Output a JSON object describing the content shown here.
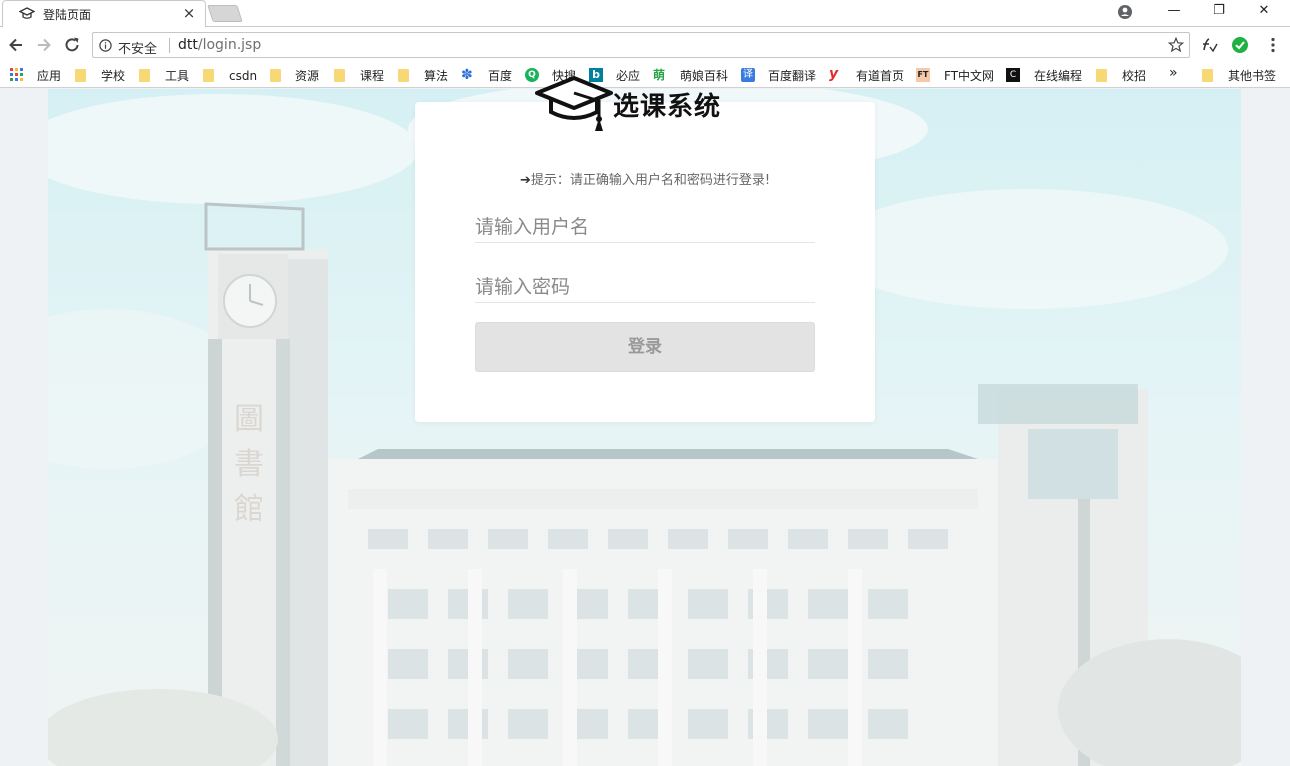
{
  "browser": {
    "tab_title": "登陆页面",
    "tab_close": "×",
    "security_label": "不安全",
    "url_host": "dtt",
    "url_path": "/login.jsp",
    "window_controls": {
      "minimize": "—",
      "restore": "❐",
      "close": "✕"
    }
  },
  "bookmarks": {
    "items": [
      {
        "label": "应用",
        "icon": "apps-grid-icon"
      },
      {
        "label": "学校",
        "icon": "folder-icon"
      },
      {
        "label": "工具",
        "icon": "folder-icon"
      },
      {
        "label": "csdn",
        "icon": "folder-icon"
      },
      {
        "label": "资源",
        "icon": "folder-icon"
      },
      {
        "label": "课程",
        "icon": "folder-icon"
      },
      {
        "label": "算法",
        "icon": "folder-icon"
      },
      {
        "label": "百度",
        "icon": "baidu-icon"
      },
      {
        "label": "快搜",
        "icon": "kuaisou-icon"
      },
      {
        "label": "必应",
        "icon": "bing-icon"
      },
      {
        "label": "萌娘百科",
        "icon": "moegirl-icon"
      },
      {
        "label": "百度翻译",
        "icon": "baidu-translate-icon"
      },
      {
        "label": "有道首页",
        "icon": "youdao-icon"
      },
      {
        "label": "FT中文网",
        "icon": "ft-icon"
      },
      {
        "label": "在线编程",
        "icon": "online-coding-icon"
      },
      {
        "label": "校招",
        "icon": "folder-icon"
      }
    ],
    "overflow": "»",
    "other_bookmarks": "其他书签",
    "glyphs": {
      "baidu": "✽",
      "kuaisou": "Q",
      "bing": "b",
      "moegirl": "萌",
      "baidu_translate": "译",
      "youdao": "y",
      "ft": "FT",
      "online": "C"
    }
  },
  "login": {
    "brand_title": "选课系统",
    "hint_arrow": "➔",
    "hint_text": "提示：请正确输入用户名和密码进行登录!",
    "username_placeholder": "请输入用户名",
    "password_placeholder": "请输入密码",
    "login_button": "登录"
  },
  "colors": {
    "button_bg": "#e3e3e3",
    "button_text": "#999999",
    "card_bg": "#ffffff",
    "ext_green": "#1fb141"
  }
}
